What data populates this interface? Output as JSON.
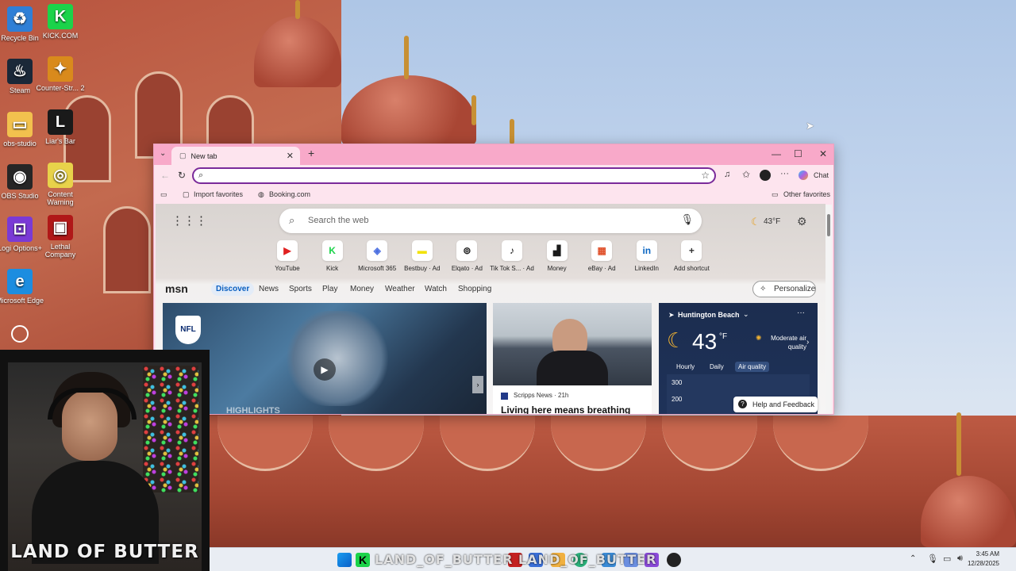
{
  "desktop": {
    "icons": [
      {
        "label": "Recycle Bin",
        "glyph": "♻",
        "color": "#2f7fd6"
      },
      {
        "label": "KICK.COM",
        "glyph": "K",
        "color": "#1bd34a"
      },
      {
        "label": "Steam",
        "glyph": "♨",
        "color": "#1b2838"
      },
      {
        "label": "Counter-Str... 2",
        "glyph": "✦",
        "color": "#d98a1c"
      },
      {
        "label": "obs-studio",
        "glyph": "▭",
        "color": "#f2c14e"
      },
      {
        "label": "Liar's Bar",
        "glyph": "L",
        "color": "#1a1a1a"
      },
      {
        "label": "OBS Studio",
        "glyph": "◉",
        "color": "#262626"
      },
      {
        "label": "Content Warning",
        "glyph": "◎",
        "color": "#e8d24a"
      },
      {
        "label": "Logi Options+",
        "glyph": "⊡",
        "color": "#7a3ad6"
      },
      {
        "label": "Lethal Company",
        "glyph": "▣",
        "color": "#b01818"
      },
      {
        "label": "Microsoft Edge",
        "glyph": "e",
        "color": "#1c8de0"
      }
    ]
  },
  "browser": {
    "tab_title": "New tab",
    "new_tab_glyph": "+",
    "tab_close_glyph": "✕",
    "window_controls": {
      "minimize": "—",
      "maximize": "☐",
      "close": "✕"
    },
    "address_value": "",
    "chat_label": "Chat",
    "favorites": {
      "import": "Import favorites",
      "booking": "Booking.com",
      "other": "Other favorites"
    },
    "newtab": {
      "search_placeholder": "Search the web",
      "weather_temp": "43°F",
      "shortcuts": [
        {
          "label": "YouTube",
          "glyph": "▶",
          "color": "#e02020"
        },
        {
          "label": "Kick",
          "glyph": "K",
          "color": "#1bd34a"
        },
        {
          "label": "Microsoft 365",
          "glyph": "◈",
          "color": "#4a6ee0"
        },
        {
          "label": "Bestbuy · Ad",
          "glyph": "▬",
          "color": "#f2e20a"
        },
        {
          "label": "Elqato · Ad",
          "glyph": "⊚",
          "color": "#222222"
        },
        {
          "label": "Tik Tok S... · Ad",
          "glyph": "♪",
          "color": "#111111"
        },
        {
          "label": "Money",
          "glyph": "▟",
          "color": "#1a1a1a"
        },
        {
          "label": "eBay · Ad",
          "glyph": "▦",
          "color": "#e0502a"
        },
        {
          "label": "LinkedIn",
          "glyph": "in",
          "color": "#0a66c2"
        },
        {
          "label": "Add shortcut",
          "glyph": "+",
          "color": "#333333"
        }
      ],
      "msn_logo": "msn",
      "nav": [
        "Discover",
        "News",
        "Sports",
        "Play",
        "Money",
        "Weather",
        "Watch",
        "Shopping"
      ],
      "personalize": "Personalize",
      "card1_overlay": "HIGHLIGHTS",
      "card1_badge": "NFL",
      "card2_source": "Scripps News · 21h",
      "card2_headline": "Living here means breathing",
      "weather": {
        "location": "Huntington Beach",
        "temp": "43",
        "unit": "°F",
        "air": "Moderate air quality",
        "tabs": [
          "Hourly",
          "Daily",
          "Air quality"
        ],
        "scale": [
          "300",
          "200"
        ]
      },
      "help": "Help and Feedback"
    }
  },
  "webcam": {
    "banner": "LAND OF BUTTER"
  },
  "taskbar": {
    "overlay_text": "LAND_OF_BUTTER  LAND_OF_BUTTER",
    "time": "3:45 AM",
    "date": "12/28/2025"
  }
}
